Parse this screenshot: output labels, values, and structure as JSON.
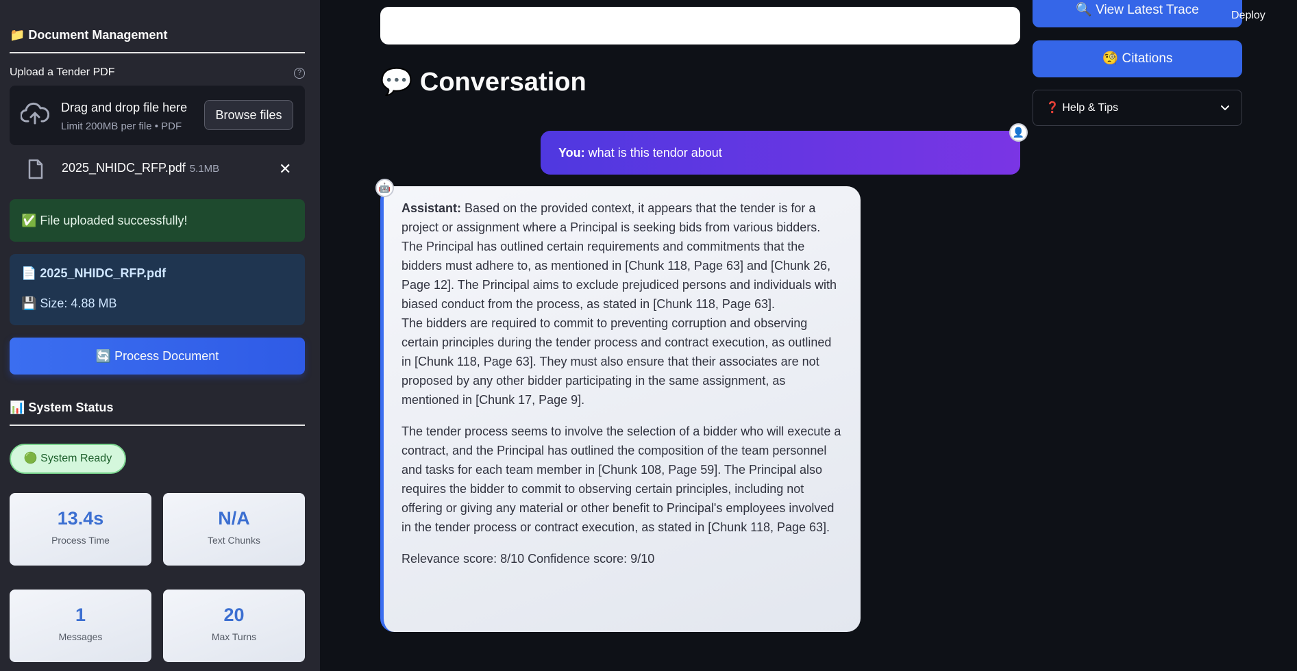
{
  "sidebar": {
    "doc_mgmt_title": "📁 Document Management",
    "upload_label": "Upload a Tender PDF",
    "help_glyph": "?",
    "dropzone": {
      "title": "Drag and drop file here",
      "subtitle": "Limit 200MB per file • PDF",
      "browse_label": "Browse files"
    },
    "uploaded_file": {
      "name": "2025_NHIDC_RFP.pdf",
      "size": "5.1MB",
      "close_glyph": "✕"
    },
    "success_msg": "✅ File uploaded successfully!",
    "file_info": {
      "name": "📄 2025_NHIDC_RFP.pdf",
      "size": "💾 Size: 4.88 MB"
    },
    "process_label": "🔄 Process Document",
    "system_status_title": "📊 System Status",
    "status_pill": "🟢 System Ready",
    "metrics": [
      {
        "value": "13.4s",
        "label": "Process Time"
      },
      {
        "value": "N/A",
        "label": "Text Chunks"
      },
      {
        "value": "1",
        "label": "Messages"
      },
      {
        "value": "20",
        "label": "Max Turns"
      }
    ]
  },
  "main": {
    "conversation_title": "💬 Conversation",
    "user_message": {
      "prefix": "You:",
      "text": "what is this tendor about",
      "avatar": "👤"
    },
    "assistant_message": {
      "avatar": "🤖",
      "prefix": "Assistant:",
      "p1": "Based on the provided context, it appears that the tender is for a project or assignment where a Principal is seeking bids from various bidders. The Principal has outlined certain requirements and commitments that the bidders must adhere to, as mentioned in [Chunk 118, Page 63] and [Chunk 26, Page 12]. The Principal aims to exclude prejudiced persons and individuals with biased conduct from the process, as stated in [Chunk 118, Page 63].",
      "p2": "The bidders are required to commit to preventing corruption and observing certain principles during the tender process and contract execution, as outlined in [Chunk 118, Page 63]. They must also ensure that their associates are not proposed by any other bidder participating in the same assignment, as mentioned in [Chunk 17, Page 9].",
      "p3": "The tender process seems to involve the selection of a bidder who will execute a contract, and the Principal has outlined the composition of the team personnel and tasks for each team member in [Chunk 108, Page 59]. The Principal also requires the bidder to commit to observing certain principles, including not offering or giving any material or other benefit to Principal's employees involved in the tender process or contract execution, as stated in [Chunk 118, Page 63].",
      "scores": "Relevance score: 8/10 Confidence score: 9/10"
    }
  },
  "right": {
    "trace_label": "🔍 View Latest Trace",
    "deploy_label": "Deploy",
    "citations_label": "🧐 Citations",
    "help_label": "❓ Help & Tips",
    "help_chevron": "⌄"
  },
  "colors": {
    "sidebar_bg": "#262730",
    "main_bg": "#0e1117",
    "accent_blue": "#3566e8",
    "user_bubble": "#5a38e2",
    "metric_value": "#3c6fd1"
  }
}
